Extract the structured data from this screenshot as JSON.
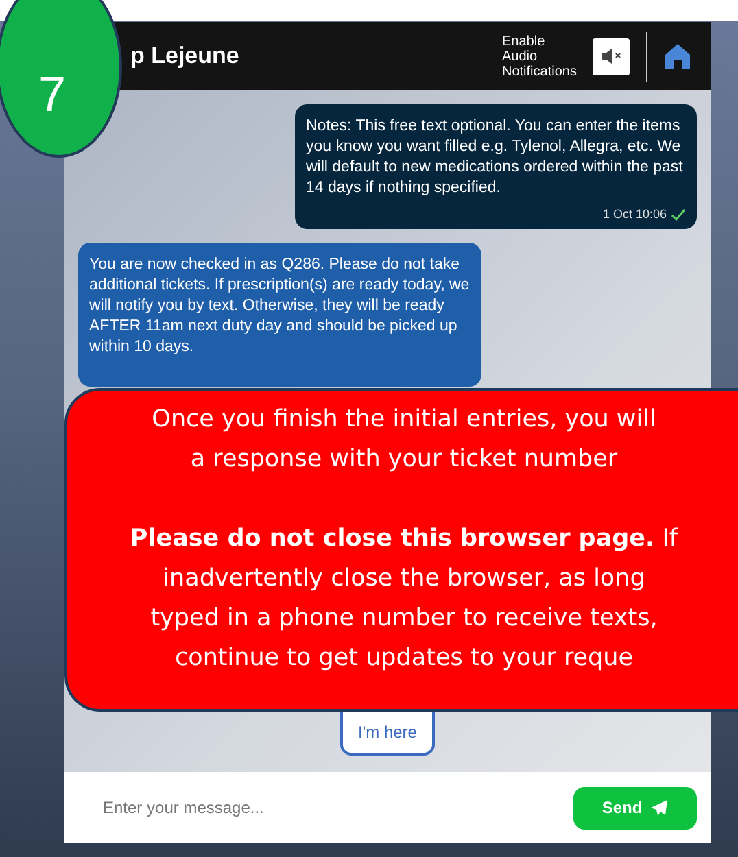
{
  "step_badge": "7",
  "header": {
    "title": "p Lejeune",
    "audio_label": "Enable Audio Notifications",
    "audio_muted": true
  },
  "messages": [
    {
      "kind": "sent",
      "text": "Notes: This free text optional. You can enter the items you know you want filled e.g. Tylenol, Allegra, etc. We will default to new medications ordered within the past 14 days if nothing specified.",
      "time": "1 Oct 10:06",
      "read": true
    },
    {
      "kind": "received",
      "text": "You are now checked in as Q286. Please do not take additional tickets. If prescription(s) are ready today, we will notify you by text. Otherwise, they will be ready AFTER 11am next duty day and should be picked up within 10 days."
    }
  ],
  "quick_reply": "I'm here",
  "callout": {
    "paragraphs": [
      [
        "Once you finish the initial entries, you will",
        "a response with your ticket number"
      ],
      [
        "**Please do not close this browser page.** If",
        "inadvertently close the browser, as long",
        "typed in a phone number to receive texts,",
        "continue to get updates to your reque"
      ]
    ]
  },
  "composer": {
    "placeholder": "Enter your message...",
    "send_label": "Send"
  }
}
